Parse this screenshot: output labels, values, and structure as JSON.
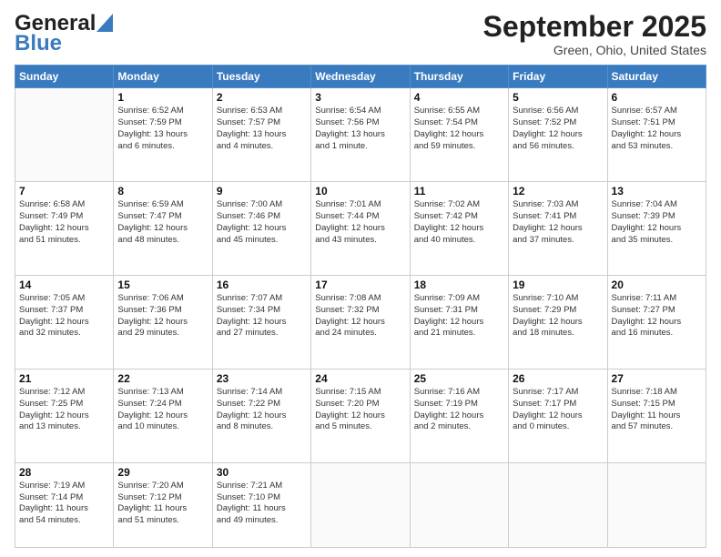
{
  "header": {
    "logo_general": "General",
    "logo_blue": "Blue",
    "month": "September 2025",
    "location": "Green, Ohio, United States"
  },
  "weekdays": [
    "Sunday",
    "Monday",
    "Tuesday",
    "Wednesday",
    "Thursday",
    "Friday",
    "Saturday"
  ],
  "weeks": [
    [
      {
        "day": "",
        "info": ""
      },
      {
        "day": "1",
        "info": "Sunrise: 6:52 AM\nSunset: 7:59 PM\nDaylight: 13 hours\nand 6 minutes."
      },
      {
        "day": "2",
        "info": "Sunrise: 6:53 AM\nSunset: 7:57 PM\nDaylight: 13 hours\nand 4 minutes."
      },
      {
        "day": "3",
        "info": "Sunrise: 6:54 AM\nSunset: 7:56 PM\nDaylight: 13 hours\nand 1 minute."
      },
      {
        "day": "4",
        "info": "Sunrise: 6:55 AM\nSunset: 7:54 PM\nDaylight: 12 hours\nand 59 minutes."
      },
      {
        "day": "5",
        "info": "Sunrise: 6:56 AM\nSunset: 7:52 PM\nDaylight: 12 hours\nand 56 minutes."
      },
      {
        "day": "6",
        "info": "Sunrise: 6:57 AM\nSunset: 7:51 PM\nDaylight: 12 hours\nand 53 minutes."
      }
    ],
    [
      {
        "day": "7",
        "info": "Sunrise: 6:58 AM\nSunset: 7:49 PM\nDaylight: 12 hours\nand 51 minutes."
      },
      {
        "day": "8",
        "info": "Sunrise: 6:59 AM\nSunset: 7:47 PM\nDaylight: 12 hours\nand 48 minutes."
      },
      {
        "day": "9",
        "info": "Sunrise: 7:00 AM\nSunset: 7:46 PM\nDaylight: 12 hours\nand 45 minutes."
      },
      {
        "day": "10",
        "info": "Sunrise: 7:01 AM\nSunset: 7:44 PM\nDaylight: 12 hours\nand 43 minutes."
      },
      {
        "day": "11",
        "info": "Sunrise: 7:02 AM\nSunset: 7:42 PM\nDaylight: 12 hours\nand 40 minutes."
      },
      {
        "day": "12",
        "info": "Sunrise: 7:03 AM\nSunset: 7:41 PM\nDaylight: 12 hours\nand 37 minutes."
      },
      {
        "day": "13",
        "info": "Sunrise: 7:04 AM\nSunset: 7:39 PM\nDaylight: 12 hours\nand 35 minutes."
      }
    ],
    [
      {
        "day": "14",
        "info": "Sunrise: 7:05 AM\nSunset: 7:37 PM\nDaylight: 12 hours\nand 32 minutes."
      },
      {
        "day": "15",
        "info": "Sunrise: 7:06 AM\nSunset: 7:36 PM\nDaylight: 12 hours\nand 29 minutes."
      },
      {
        "day": "16",
        "info": "Sunrise: 7:07 AM\nSunset: 7:34 PM\nDaylight: 12 hours\nand 27 minutes."
      },
      {
        "day": "17",
        "info": "Sunrise: 7:08 AM\nSunset: 7:32 PM\nDaylight: 12 hours\nand 24 minutes."
      },
      {
        "day": "18",
        "info": "Sunrise: 7:09 AM\nSunset: 7:31 PM\nDaylight: 12 hours\nand 21 minutes."
      },
      {
        "day": "19",
        "info": "Sunrise: 7:10 AM\nSunset: 7:29 PM\nDaylight: 12 hours\nand 18 minutes."
      },
      {
        "day": "20",
        "info": "Sunrise: 7:11 AM\nSunset: 7:27 PM\nDaylight: 12 hours\nand 16 minutes."
      }
    ],
    [
      {
        "day": "21",
        "info": "Sunrise: 7:12 AM\nSunset: 7:25 PM\nDaylight: 12 hours\nand 13 minutes."
      },
      {
        "day": "22",
        "info": "Sunrise: 7:13 AM\nSunset: 7:24 PM\nDaylight: 12 hours\nand 10 minutes."
      },
      {
        "day": "23",
        "info": "Sunrise: 7:14 AM\nSunset: 7:22 PM\nDaylight: 12 hours\nand 8 minutes."
      },
      {
        "day": "24",
        "info": "Sunrise: 7:15 AM\nSunset: 7:20 PM\nDaylight: 12 hours\nand 5 minutes."
      },
      {
        "day": "25",
        "info": "Sunrise: 7:16 AM\nSunset: 7:19 PM\nDaylight: 12 hours\nand 2 minutes."
      },
      {
        "day": "26",
        "info": "Sunrise: 7:17 AM\nSunset: 7:17 PM\nDaylight: 12 hours\nand 0 minutes."
      },
      {
        "day": "27",
        "info": "Sunrise: 7:18 AM\nSunset: 7:15 PM\nDaylight: 11 hours\nand 57 minutes."
      }
    ],
    [
      {
        "day": "28",
        "info": "Sunrise: 7:19 AM\nSunset: 7:14 PM\nDaylight: 11 hours\nand 54 minutes."
      },
      {
        "day": "29",
        "info": "Sunrise: 7:20 AM\nSunset: 7:12 PM\nDaylight: 11 hours\nand 51 minutes."
      },
      {
        "day": "30",
        "info": "Sunrise: 7:21 AM\nSunset: 7:10 PM\nDaylight: 11 hours\nand 49 minutes."
      },
      {
        "day": "",
        "info": ""
      },
      {
        "day": "",
        "info": ""
      },
      {
        "day": "",
        "info": ""
      },
      {
        "day": "",
        "info": ""
      }
    ]
  ]
}
